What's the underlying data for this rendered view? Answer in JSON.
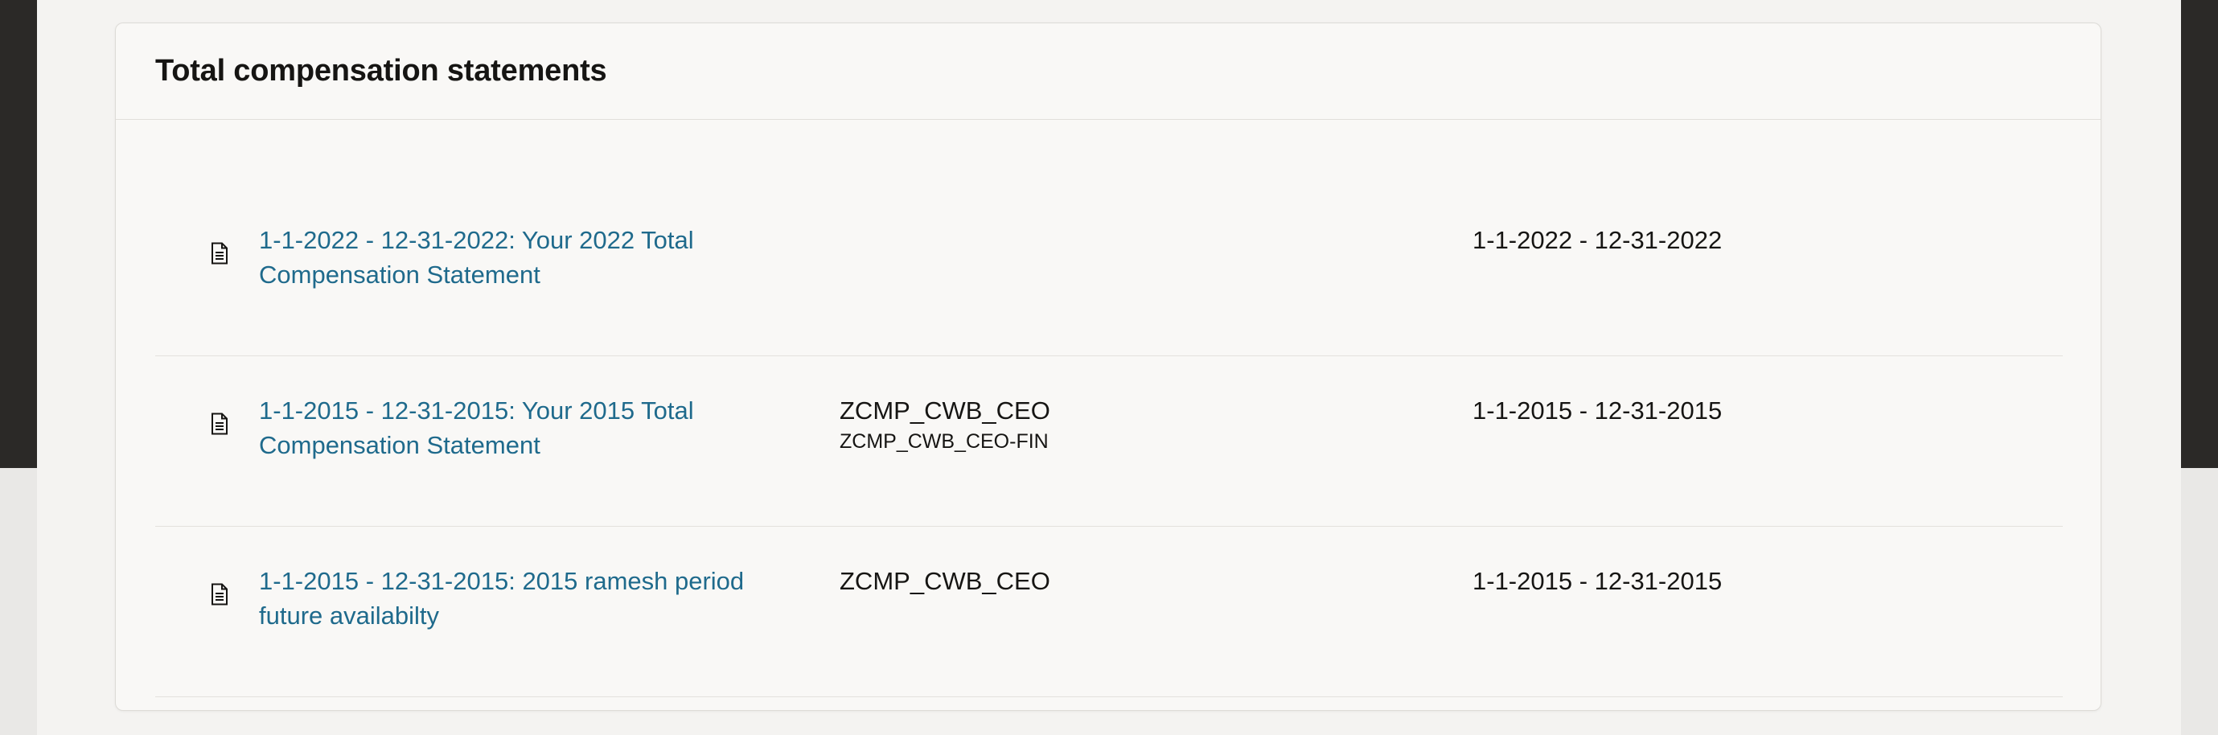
{
  "section": {
    "title": "Total compensation statements"
  },
  "statements": [
    {
      "name": "1-1-2022 - 12-31-2022: Your 2022 Total Compensation Statement",
      "code": "",
      "code_sub": "",
      "period": "1-1-2022 - 12-31-2022",
      "icon": "document-icon"
    },
    {
      "name": "1-1-2015 - 12-31-2015: Your 2015 Total Compensation Statement",
      "code": "ZCMP_CWB_CEO",
      "code_sub": "ZCMP_CWB_CEO-FIN",
      "period": "1-1-2015 - 12-31-2015",
      "icon": "document-icon"
    },
    {
      "name": "1-1-2015 - 12-31-2015: 2015 ramesh period future availabilty",
      "code": "ZCMP_CWB_CEO",
      "code_sub": "",
      "period": "1-1-2015 - 12-31-2015",
      "icon": "document-icon"
    }
  ]
}
